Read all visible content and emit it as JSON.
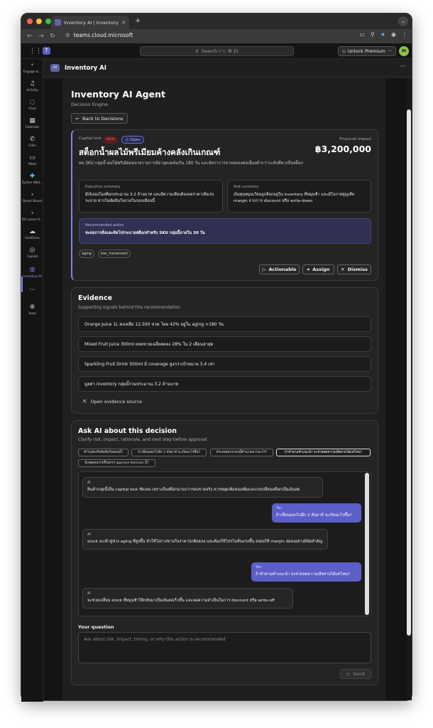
{
  "browser": {
    "tab_title": "Inventory AI | Inventory AI | M",
    "new_tab": "+",
    "url": "teams.cloud.microsoft"
  },
  "teams": {
    "search_placeholder": "Search (⌥ ⌘ E)",
    "premium_label": "Unlock Premium",
    "avatar_initials": "AI",
    "rail": [
      {
        "label": "Engage &...",
        "icon": "engage-icon"
      },
      {
        "label": "Activity",
        "icon": "bell-icon"
      },
      {
        "label": "Chat",
        "icon": "chat-icon"
      },
      {
        "label": "Calendar",
        "icon": "calendar-icon"
      },
      {
        "label": "Calls",
        "icon": "phone-icon"
      },
      {
        "label": "Meet",
        "icon": "video-icon"
      },
      {
        "label": "ZyGen Wall...",
        "icon": "zygen-icon"
      },
      {
        "label": "Quest Board",
        "icon": "chevron-icon"
      },
      {
        "label": "ZG Leave R...",
        "icon": "chevron-icon"
      },
      {
        "label": "OneDrive",
        "icon": "cloud-icon"
      },
      {
        "label": "Copilot",
        "icon": "copilot-icon"
      },
      {
        "label": "Inventory AI",
        "icon": "inventory-icon"
      },
      {
        "label": "...",
        "icon": "more-icon"
      },
      {
        "label": "Apps",
        "icon": "apps-icon"
      }
    ],
    "app_title": "Inventory AI"
  },
  "page": {
    "title": "Inventory AI Agent",
    "subtitle": "Decision Engine",
    "back_label": "Back to Decisions"
  },
  "recommendation": {
    "category": "Capital lock",
    "severity": "HIGH",
    "status": "Open",
    "title": "สต็อกน้ำผลไม้พรีเมียมค้างคลังเกินเกณฑ์",
    "impact_label": "Financial impact",
    "impact_value": "฿3,200,000",
    "description": "พบ SKU กลุ่มน้ำผลไม้พรีเมียมหลายรายการมีอายุคงคลังเกิน 180 วัน และอัตราการขายลดลงต่อเนื่องต่ำกว่าระดับที่ควรถือสต็อก",
    "exec_summary_label": "Executive summary",
    "exec_summary": "มีเงินจมในสต็อกประมาณ 3.2 ล้านบาท และมีความเสี่ยงต้องลดราคาเพื่อเร่งระบาย หากไม่ตัดสินใจภายในรอบเดือนนี้",
    "risk_summary_label": "Risk summary",
    "risk_summary": "เงินทุนหมุนเวียนถูกล็อกอยู่ใน inventory ที่หมุนช้า และมีโอกาสสูญเสีย margin จากการ discount หรือ write-down",
    "action_label": "Recommended action",
    "action_text": "ชะลอการสั่งและจัดโปรระบายสต็อกสำหรับ SKU กลุ่มนี้ภายใน 30 วัน",
    "tags": [
      "aging",
      "low_movement"
    ],
    "buttons": {
      "actionable": "Actionable",
      "assign": "Assign",
      "dismiss": "Dismiss"
    }
  },
  "evidence": {
    "title": "Evidence",
    "subtitle": "Supporting signals behind this recommendation",
    "items": [
      "Orange Juice 1L คงเหลือ 12,500 ขวด โดย 42% อยู่ใน aging >180 วัน",
      "Mixed Fruit Juice 300ml ยอดขายเฉลี่ยลดลง 28% ใน 2 เดือนล่าสุด",
      "Sparkling Fruit Drink 500ml มี coverage สูงกว่าเป้าหมาย 3.4 เท่า",
      "มูลค่า inventory กลุ่มนี้รวมประมาณ 3.2 ล้านบาท"
    ],
    "link": "Open evidence source"
  },
  "ask": {
    "title": "Ask AI about this decision",
    "subtitle": "Clarify risk, impact, rationale, and next step before approval",
    "chips": [
      "ทำไมต้องรีบตัดสินใจตอนนี้?",
      "ถ้าเลื่อนออกไปอีก 2 สัปดาห์ จะเกิดอะไรขึ้น?",
      "ตัวเลขผลกระทบนี้คำนวณจากอะไร?",
      "ถ้าทำตามคำแนะนำ จะช่วยลดความเสียหายได้แค่ไหน?",
      "มีเหตุผลอะไรที่ไม่ควร approve decision นี้?"
    ],
    "selected_chip_index": 3,
    "messages": [
      {
        "role": "AI",
        "text": "สินค้ากลุ่มนี้เป็น capital lock ชัดเจน เพราะถือสต็อกนานกว่ารอบขายจริง ควรหยุดเติมของเพิ่มและเร่งเปลี่ยนสต็อกเป็นเงินสด"
      },
      {
        "role": "You",
        "text": "ถ้าเลื่อนออกไปอีก 2 สัปดาห์ จะเกิดอะไรขึ้น?"
      },
      {
        "role": "AI",
        "text": "stock จะเข้าสู่ช่วง aging ที่สูงขึ้น ทำให้โอกาสขายในราคาปกติลดลง และต้องใช้โปรโมชั่นแรงขึ้น ส่งผลให้ margin ลดลงอย่างมีนัยสำคัญ"
      },
      {
        "role": "You",
        "text": "ถ้าทำตามคำแนะนำ จะช่วยลดความเสียหายได้แค่ไหน?"
      },
      {
        "role": "AI",
        "text": "จะช่วยเปลี่ยน stock ที่หมุนช้าให้กลับมาเป็นเงินสดเร็วขึ้น และลดความจำเป็นในการ discount หรือ write-off"
      }
    ],
    "question_label": "Your question",
    "question_placeholder": "Ask about risk, impact, timing, or why this action is recommended",
    "send_label": "Send"
  },
  "colors": {
    "accent": "#7f85f5",
    "user_bubble": "#5b5fc7",
    "high_badge": "#5a1d1d",
    "background": "#1f1f1f"
  }
}
